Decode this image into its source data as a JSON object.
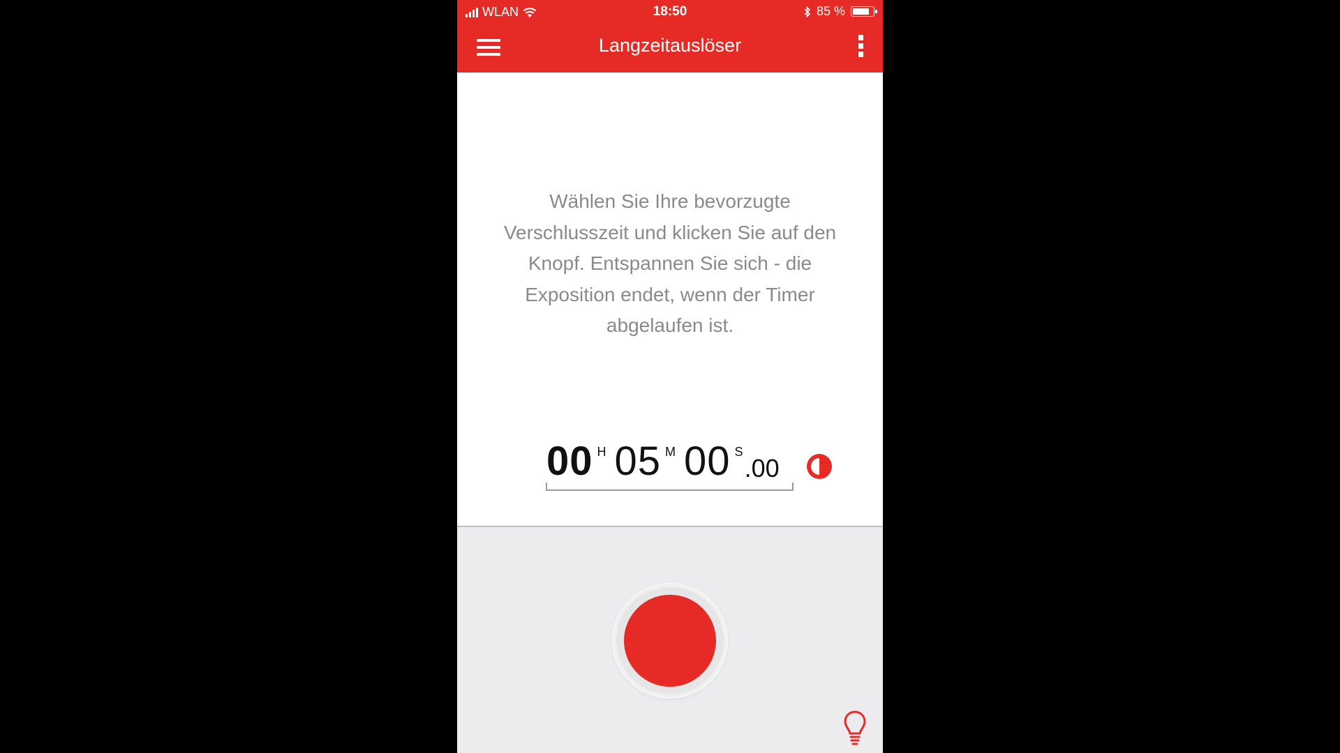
{
  "status_bar": {
    "carrier": "WLAN",
    "time": "18:50",
    "battery_percent": "85 %",
    "battery_level": 0.85,
    "icons": [
      "signal-icon",
      "wifi-icon",
      "bluetooth-icon",
      "battery-icon"
    ]
  },
  "app_bar": {
    "title": "Langzeitauslöser",
    "menu_icon": "hamburger-icon",
    "overflow_icon": "kebab-menu-icon"
  },
  "main": {
    "instruction": "Wählen Sie Ihre bevorzugte Verschlusszeit und klicken Sie auf den Knopf. Entspannen Sie sich - die Exposition endet, wenn der Timer abgelaufen ist.",
    "timer": {
      "hours": "00",
      "hours_unit": "H",
      "minutes": "05",
      "minutes_unit": "M",
      "seconds": "00",
      "seconds_unit": "S",
      "fraction": ".00"
    },
    "contrast_icon": "contrast-icon"
  },
  "bottom": {
    "shutter_button": "shutter-button",
    "tip_icon": "lightbulb-icon"
  },
  "colors": {
    "accent": "#e62b26",
    "instruction_text": "#8a8a8a",
    "panel_background": "#ececee"
  }
}
